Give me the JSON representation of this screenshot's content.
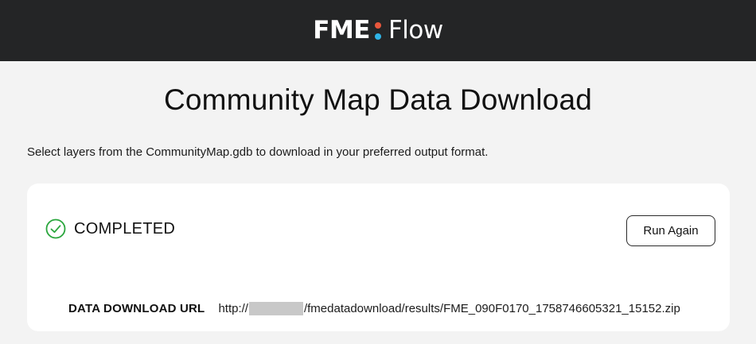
{
  "header": {
    "logo_left": "FME",
    "logo_right": "Flow",
    "dot_colors": [
      "#e8573c",
      "#2fb4e6"
    ]
  },
  "page": {
    "title": "Community Map Data Download",
    "description": "Select layers from the CommunityMap.gdb to download in your preferred output format."
  },
  "result": {
    "status_text": "COMPLETED",
    "status_color": "#2aa63d",
    "run_again_label": "Run Again",
    "url_label": "DATA DOWNLOAD URL",
    "url_prefix": "http://",
    "url_suffix": "/fmedatadownload/results/FME_090F0170_1758746605321_15152.zip"
  }
}
